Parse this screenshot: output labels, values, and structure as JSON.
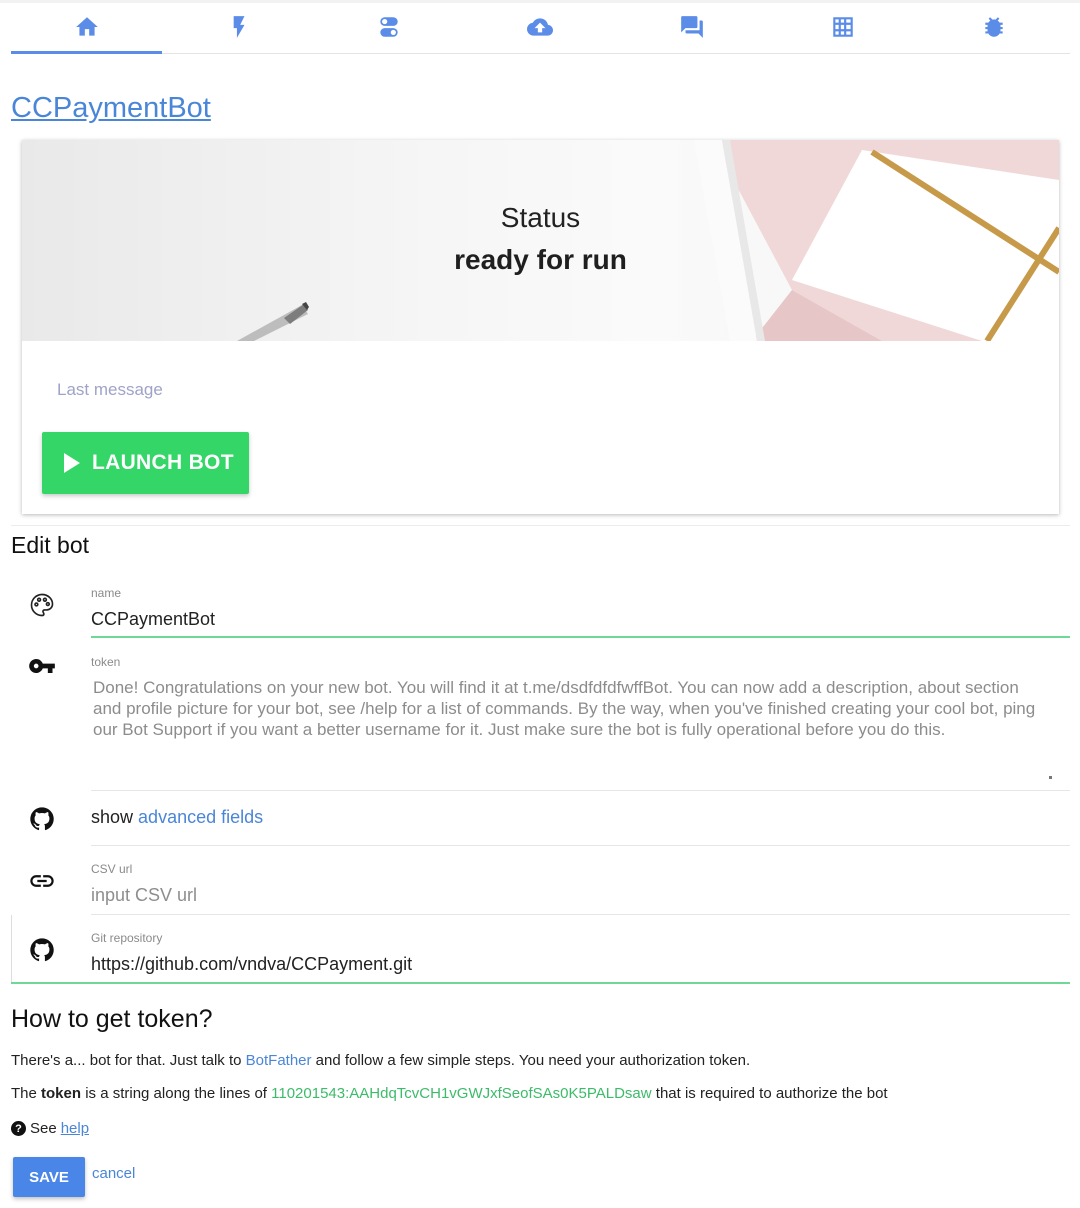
{
  "tabs": [
    {
      "icon": "home-icon",
      "active": true
    },
    {
      "icon": "lightning-icon",
      "active": false
    },
    {
      "icon": "toggles-icon",
      "active": false
    },
    {
      "icon": "cloud-upload-icon",
      "active": false
    },
    {
      "icon": "chat-icon",
      "active": false
    },
    {
      "icon": "grid-icon",
      "active": false
    },
    {
      "icon": "bug-icon",
      "active": false
    }
  ],
  "bot": {
    "title": "CCPaymentBot"
  },
  "status_card": {
    "label": "Status",
    "value": "ready for run",
    "last_message_label": "Last message",
    "launch_label": "LAUNCH BOT"
  },
  "edit": {
    "title": "Edit bot",
    "name_caption": "name",
    "name_value": "CCPaymentBot",
    "token_caption": "token",
    "token_value": "Done! Congratulations on your new bot. You will find it at t.me/dsdfdfdfwffBot. You can now add a description, about section and profile picture for your bot, see /help for a list of commands. By the way, when you've finished creating your cool bot, ping our Bot Support if you want a better username for it. Just make sure the bot is fully operational before you do this.",
    "show_prefix": "show",
    "show_link": "advanced fields",
    "csv_caption": "CSV url",
    "csv_placeholder": "input CSV url",
    "git_caption": "Git repository",
    "git_value": "https://github.com/vndva/CCPayment.git"
  },
  "howto": {
    "title": "How to get token?",
    "p1_before": "There's a... bot for that. Just talk to ",
    "p1_link": "BotFather",
    "p1_after": " and follow a few simple steps. You need your authorization token.",
    "p2_before": "The ",
    "p2_bold": "token",
    "p2_middle": " is a string along the lines of ",
    "p2_token": "110201543:AAHdqTcvCH1vGWJxfSeofSAs0K5PALDsaw",
    "p2_after": " that is required to authorize the bot",
    "see_label": "See",
    "help_link": "help"
  },
  "actions": {
    "save_label": "SAVE",
    "cancel_label": "cancel"
  },
  "colors": {
    "accent": "#5b8de8",
    "success": "#33d667",
    "link": "#4a86d8",
    "token_green": "#3dbb6a"
  }
}
